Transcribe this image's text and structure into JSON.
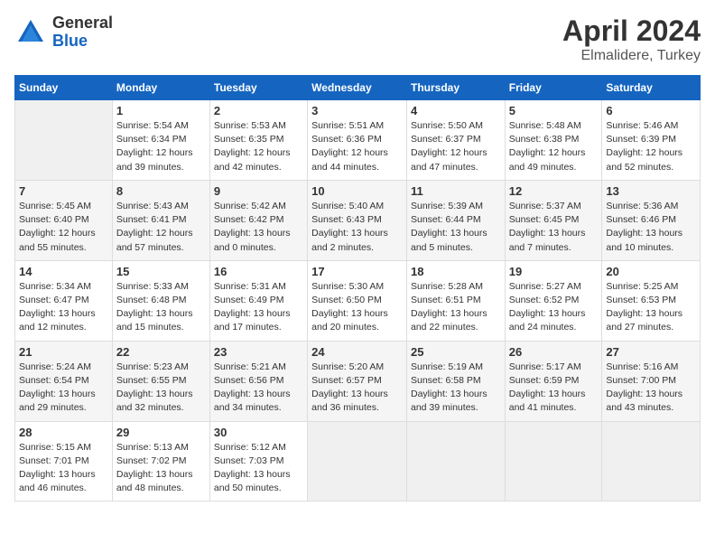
{
  "header": {
    "logo_general": "General",
    "logo_blue": "Blue",
    "title": "April 2024",
    "subtitle": "Elmalidere, Turkey"
  },
  "columns": [
    "Sunday",
    "Monday",
    "Tuesday",
    "Wednesday",
    "Thursday",
    "Friday",
    "Saturday"
  ],
  "weeks": [
    [
      {
        "day": "",
        "info": ""
      },
      {
        "day": "1",
        "info": "Sunrise: 5:54 AM\nSunset: 6:34 PM\nDaylight: 12 hours\nand 39 minutes."
      },
      {
        "day": "2",
        "info": "Sunrise: 5:53 AM\nSunset: 6:35 PM\nDaylight: 12 hours\nand 42 minutes."
      },
      {
        "day": "3",
        "info": "Sunrise: 5:51 AM\nSunset: 6:36 PM\nDaylight: 12 hours\nand 44 minutes."
      },
      {
        "day": "4",
        "info": "Sunrise: 5:50 AM\nSunset: 6:37 PM\nDaylight: 12 hours\nand 47 minutes."
      },
      {
        "day": "5",
        "info": "Sunrise: 5:48 AM\nSunset: 6:38 PM\nDaylight: 12 hours\nand 49 minutes."
      },
      {
        "day": "6",
        "info": "Sunrise: 5:46 AM\nSunset: 6:39 PM\nDaylight: 12 hours\nand 52 minutes."
      }
    ],
    [
      {
        "day": "7",
        "info": "Sunrise: 5:45 AM\nSunset: 6:40 PM\nDaylight: 12 hours\nand 55 minutes."
      },
      {
        "day": "8",
        "info": "Sunrise: 5:43 AM\nSunset: 6:41 PM\nDaylight: 12 hours\nand 57 minutes."
      },
      {
        "day": "9",
        "info": "Sunrise: 5:42 AM\nSunset: 6:42 PM\nDaylight: 13 hours\nand 0 minutes."
      },
      {
        "day": "10",
        "info": "Sunrise: 5:40 AM\nSunset: 6:43 PM\nDaylight: 13 hours\nand 2 minutes."
      },
      {
        "day": "11",
        "info": "Sunrise: 5:39 AM\nSunset: 6:44 PM\nDaylight: 13 hours\nand 5 minutes."
      },
      {
        "day": "12",
        "info": "Sunrise: 5:37 AM\nSunset: 6:45 PM\nDaylight: 13 hours\nand 7 minutes."
      },
      {
        "day": "13",
        "info": "Sunrise: 5:36 AM\nSunset: 6:46 PM\nDaylight: 13 hours\nand 10 minutes."
      }
    ],
    [
      {
        "day": "14",
        "info": "Sunrise: 5:34 AM\nSunset: 6:47 PM\nDaylight: 13 hours\nand 12 minutes."
      },
      {
        "day": "15",
        "info": "Sunrise: 5:33 AM\nSunset: 6:48 PM\nDaylight: 13 hours\nand 15 minutes."
      },
      {
        "day": "16",
        "info": "Sunrise: 5:31 AM\nSunset: 6:49 PM\nDaylight: 13 hours\nand 17 minutes."
      },
      {
        "day": "17",
        "info": "Sunrise: 5:30 AM\nSunset: 6:50 PM\nDaylight: 13 hours\nand 20 minutes."
      },
      {
        "day": "18",
        "info": "Sunrise: 5:28 AM\nSunset: 6:51 PM\nDaylight: 13 hours\nand 22 minutes."
      },
      {
        "day": "19",
        "info": "Sunrise: 5:27 AM\nSunset: 6:52 PM\nDaylight: 13 hours\nand 24 minutes."
      },
      {
        "day": "20",
        "info": "Sunrise: 5:25 AM\nSunset: 6:53 PM\nDaylight: 13 hours\nand 27 minutes."
      }
    ],
    [
      {
        "day": "21",
        "info": "Sunrise: 5:24 AM\nSunset: 6:54 PM\nDaylight: 13 hours\nand 29 minutes."
      },
      {
        "day": "22",
        "info": "Sunrise: 5:23 AM\nSunset: 6:55 PM\nDaylight: 13 hours\nand 32 minutes."
      },
      {
        "day": "23",
        "info": "Sunrise: 5:21 AM\nSunset: 6:56 PM\nDaylight: 13 hours\nand 34 minutes."
      },
      {
        "day": "24",
        "info": "Sunrise: 5:20 AM\nSunset: 6:57 PM\nDaylight: 13 hours\nand 36 minutes."
      },
      {
        "day": "25",
        "info": "Sunrise: 5:19 AM\nSunset: 6:58 PM\nDaylight: 13 hours\nand 39 minutes."
      },
      {
        "day": "26",
        "info": "Sunrise: 5:17 AM\nSunset: 6:59 PM\nDaylight: 13 hours\nand 41 minutes."
      },
      {
        "day": "27",
        "info": "Sunrise: 5:16 AM\nSunset: 7:00 PM\nDaylight: 13 hours\nand 43 minutes."
      }
    ],
    [
      {
        "day": "28",
        "info": "Sunrise: 5:15 AM\nSunset: 7:01 PM\nDaylight: 13 hours\nand 46 minutes."
      },
      {
        "day": "29",
        "info": "Sunrise: 5:13 AM\nSunset: 7:02 PM\nDaylight: 13 hours\nand 48 minutes."
      },
      {
        "day": "30",
        "info": "Sunrise: 5:12 AM\nSunset: 7:03 PM\nDaylight: 13 hours\nand 50 minutes."
      },
      {
        "day": "",
        "info": ""
      },
      {
        "day": "",
        "info": ""
      },
      {
        "day": "",
        "info": ""
      },
      {
        "day": "",
        "info": ""
      }
    ]
  ]
}
